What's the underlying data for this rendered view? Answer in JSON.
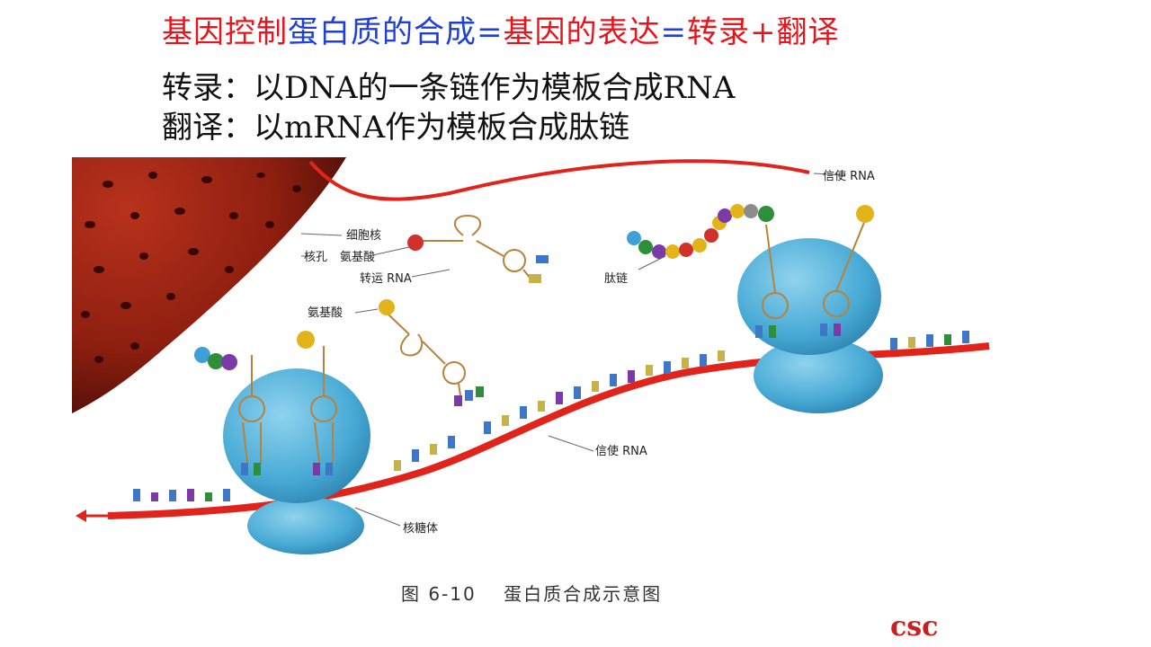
{
  "title": {
    "part1": "基因控制",
    "part2": "蛋白质",
    "part3": "的合成",
    "part4": "=",
    "part5": "基因的表达",
    "part6": "=",
    "part7": "转录+翻译"
  },
  "colors": {
    "red": "#e8141c",
    "blue": "#1f3fd6",
    "mrna": "#e0241c",
    "ribosome": "#46a9d4",
    "nucleus": "#8e1f10"
  },
  "definitions": {
    "transcription": "转录：以DNA的一条链作为模板合成RNA",
    "translation": "翻译：以mRNA作为模板合成肽链"
  },
  "labels": {
    "mrna_top": "信使 RNA",
    "nucleus": "细胞核",
    "nuclear_pore": "核孔",
    "amino_acid_1": "氨基酸",
    "trna": "转运 RNA",
    "amino_acid_2": "氨基酸",
    "peptide": "肽链",
    "mrna_bottom": "信使 RNA",
    "ribosome": "核糖体"
  },
  "caption": "图 6-10　 蛋白质合成示意图",
  "brand": "csc"
}
